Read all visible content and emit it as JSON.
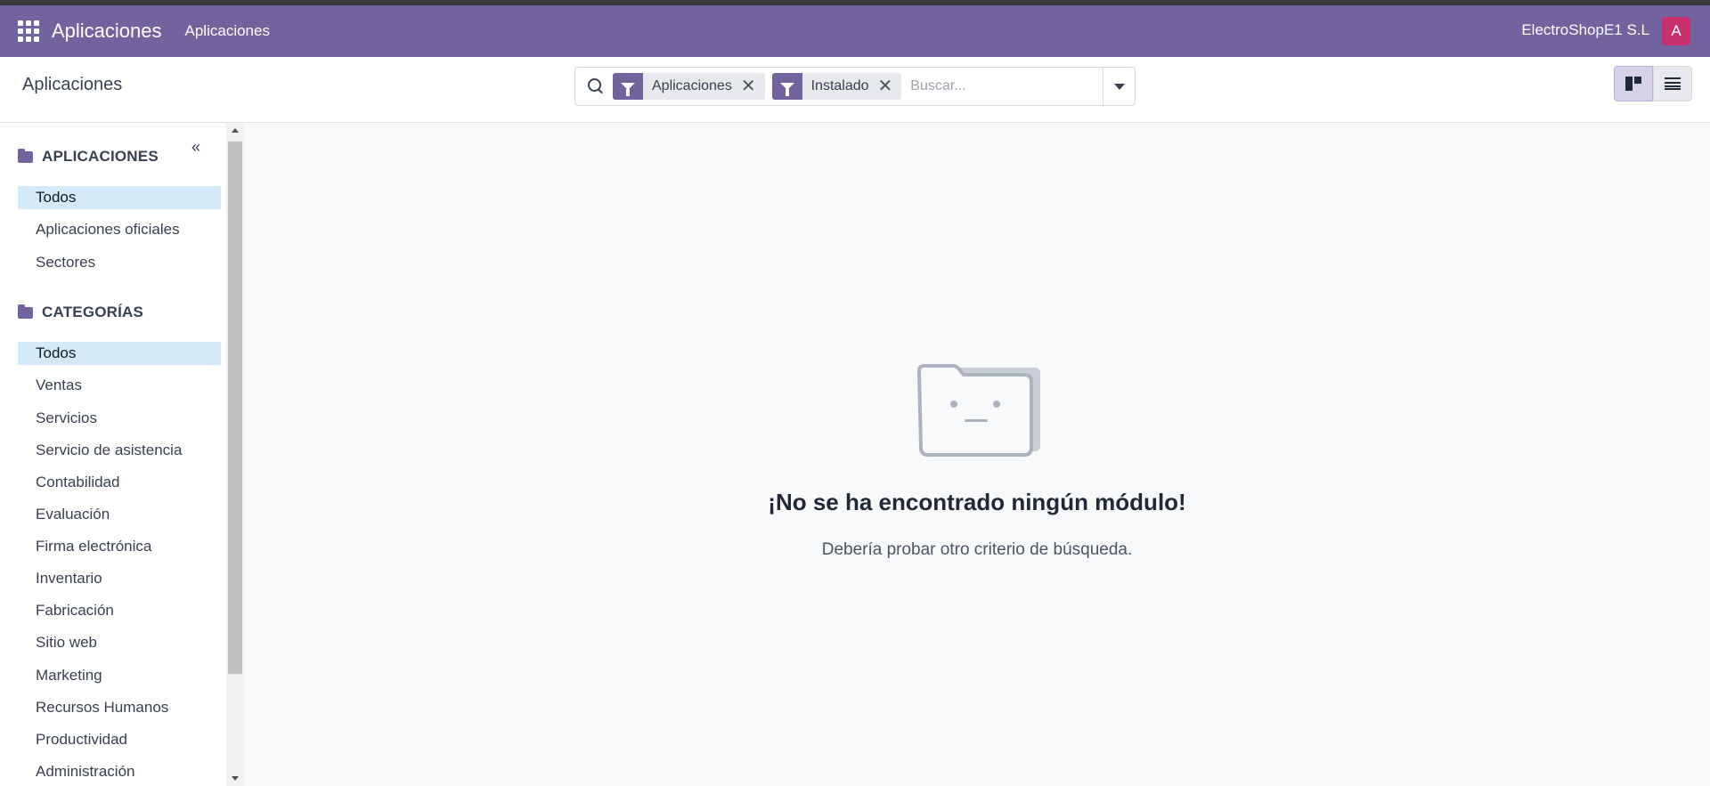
{
  "navbar": {
    "brand": "Aplicaciones",
    "menu_item": "Aplicaciones",
    "company": "ElectroShopE1 S.L",
    "avatar_letter": "A",
    "accent_color": "#71639e",
    "avatar_color": "#c7306d"
  },
  "control_panel": {
    "breadcrumb": "Aplicaciones",
    "search": {
      "facets": [
        {
          "label": "Aplicaciones",
          "icon": "filter-icon"
        },
        {
          "label": "Instalado",
          "icon": "filter-icon"
        }
      ],
      "remove_glyph": "✕",
      "placeholder": "Buscar..."
    },
    "views": [
      {
        "name": "kanban-view-icon",
        "active": true
      },
      {
        "name": "list-view-icon",
        "active": false
      }
    ]
  },
  "sidebar": {
    "collapse_glyph": "«",
    "sections": [
      {
        "title": "APLICACIONES",
        "icon": "folder-icon",
        "items": [
          {
            "label": "Todos",
            "active": true
          },
          {
            "label": "Aplicaciones oficiales",
            "active": false
          },
          {
            "label": "Sectores",
            "active": false
          }
        ]
      },
      {
        "title": "CATEGORÍAS",
        "icon": "folder-icon",
        "items": [
          {
            "label": "Todos",
            "active": true
          },
          {
            "label": "Ventas",
            "active": false
          },
          {
            "label": "Servicios",
            "active": false
          },
          {
            "label": "Servicio de asistencia",
            "active": false
          },
          {
            "label": "Contabilidad",
            "active": false
          },
          {
            "label": "Evaluación",
            "active": false
          },
          {
            "label": "Firma electrónica",
            "active": false
          },
          {
            "label": "Inventario",
            "active": false
          },
          {
            "label": "Fabricación",
            "active": false
          },
          {
            "label": "Sitio web",
            "active": false
          },
          {
            "label": "Marketing",
            "active": false
          },
          {
            "label": "Recursos Humanos",
            "active": false
          },
          {
            "label": "Productividad",
            "active": false
          },
          {
            "label": "Administración",
            "active": false
          }
        ]
      }
    ]
  },
  "empty_state": {
    "icon": "empty-folder-icon",
    "title": "¡No se ha encontrado ningún módulo!",
    "subtitle": "Debería probar otro criterio de búsqueda."
  }
}
